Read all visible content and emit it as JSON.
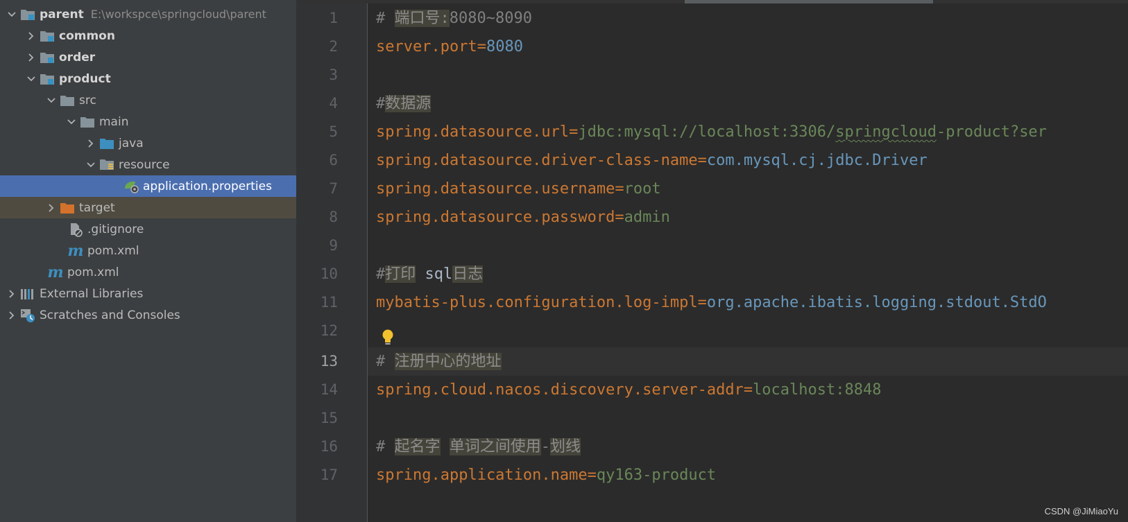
{
  "project_tree": {
    "root": {
      "name": "parent",
      "path": "E:\\workspce\\springcloud\\parent"
    },
    "items": [
      {
        "label": "common"
      },
      {
        "label": "order"
      },
      {
        "label": "product"
      },
      {
        "label": "src"
      },
      {
        "label": "main"
      },
      {
        "label": "java"
      },
      {
        "label": "resource"
      },
      {
        "label": "application.properties"
      },
      {
        "label": "target"
      },
      {
        "label": ".gitignore"
      },
      {
        "label": "pom.xml"
      },
      {
        "label": "pom.xml"
      },
      {
        "label": "External Libraries"
      },
      {
        "label": "Scratches and Consoles"
      }
    ]
  },
  "editor": {
    "current_line": 13,
    "line_numbers": [
      "1",
      "2",
      "3",
      "4",
      "5",
      "6",
      "7",
      "8",
      "9",
      "10",
      "11",
      "12",
      "13",
      "14",
      "15",
      "16",
      "17"
    ],
    "lines": [
      {
        "comment_prefix": "# ",
        "comment_hl": "端口号:",
        "comment_rest": "8080~8090"
      },
      {
        "key": "server.port",
        "eq": "=",
        "value": "8080"
      },
      {},
      {
        "comment_prefix": "#",
        "comment_hl": "数据源"
      },
      {
        "key": "spring.datasource.url",
        "eq": "=",
        "value_a": "jdbc:mysql://localhost:3306/",
        "value_squig": "springcloud",
        "value_b": "-product?ser"
      },
      {
        "key": "spring.datasource.driver-class-name",
        "eq": "=",
        "value": "com.mysql.cj.jdbc.Driver"
      },
      {
        "key": "spring.datasource.username",
        "eq": "=",
        "value": "root"
      },
      {
        "key": "spring.datasource.password",
        "eq": "=",
        "value": "admin"
      },
      {},
      {
        "comment_prefix": "#",
        "comment_hl": "打印",
        "comment_mid": " sql",
        "comment_hl2": "日志"
      },
      {
        "key": "mybatis-plus.configuration.log-impl",
        "eq": "=",
        "value": "org.apache.ibatis.logging.stdout.StdO"
      },
      {},
      {
        "comment_prefix": "# ",
        "comment_hl": "注册中心的地址"
      },
      {
        "key": "spring.cloud.nacos.discovery.server-addr",
        "eq": "=",
        "value": "localhost:8848"
      },
      {},
      {
        "comment_prefix": "# ",
        "comment_hl": "起名字",
        "comment_mid": " ",
        "comment_hl2": "单词之间使用",
        "comment_mid2": "-",
        "comment_hl3": "划线"
      },
      {
        "key": "spring.application.name",
        "eq": "=",
        "value": "qy163-product"
      }
    ]
  },
  "watermark": "CSDN @JiMiaoYu",
  "icons": {
    "module_folder": "module-folder-icon",
    "folder": "folder-icon",
    "source_folder": "source-folder-icon",
    "resource_folder": "resource-folder-icon",
    "excluded_folder": "excluded-folder-icon",
    "properties_file": "properties-file-icon",
    "gitignore_file": "gitignore-file-icon",
    "maven_file": "maven-file-icon",
    "libraries": "libraries-icon",
    "scratches": "scratches-icon",
    "bulb": "lightbulb-icon"
  },
  "colors": {
    "selection": "#4b6eaf",
    "excluded_row": "#4f4b41",
    "key": "#cc7832",
    "value_string": "#6a8759",
    "value_number": "#6897bb",
    "comment": "#808080"
  }
}
